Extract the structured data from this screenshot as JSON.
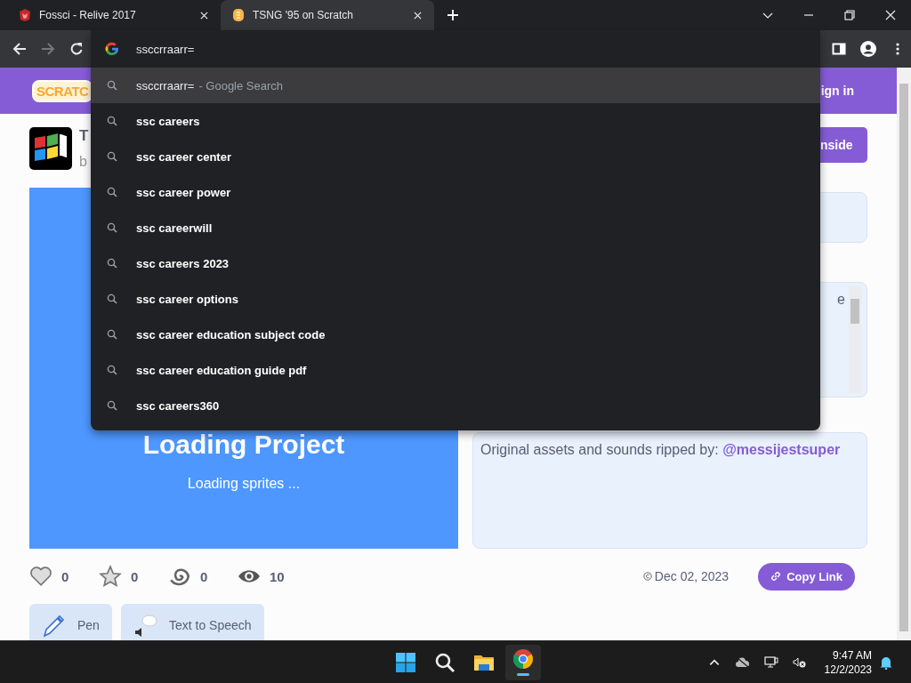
{
  "tabs": [
    {
      "title": "Fossci - Relive 2017",
      "selected": false
    },
    {
      "title": "TSNG '95 on Scratch",
      "selected": true
    }
  ],
  "omnibox": {
    "value": "ssccrraarr="
  },
  "suggestions": [
    {
      "text": "ssccrraarr=",
      "hint": "- Google Search",
      "selected": true
    },
    {
      "text": "ssc careers",
      "selected": false
    },
    {
      "text": "ssc career center",
      "selected": false
    },
    {
      "text": "ssc career power",
      "selected": false
    },
    {
      "text": "ssc careerwill",
      "selected": false
    },
    {
      "text": "ssc careers 2023",
      "selected": false
    },
    {
      "text": "ssc career options",
      "selected": false
    },
    {
      "text": "ssc career education subject code",
      "selected": false
    },
    {
      "text": "ssc career education guide pdf",
      "selected": false
    },
    {
      "text": "ssc careers360",
      "selected": false
    }
  ],
  "page": {
    "logo": "SCRATC",
    "sign_in": "ign in",
    "title_fragment": "T",
    "author_fragment": "b",
    "see_inside": "nside",
    "notes_fragment": "e",
    "stage": {
      "title": "Loading Project",
      "status": "Loading sprites ..."
    },
    "credits": {
      "text": "Original assets and sounds ripped by: ",
      "link": "@messijestsuper"
    },
    "stats": [
      {
        "kind": "love",
        "count": "0"
      },
      {
        "kind": "favorite",
        "count": "0"
      },
      {
        "kind": "remix",
        "count": "0"
      },
      {
        "kind": "view",
        "count": "10"
      }
    ],
    "date": "Dec 02, 2023",
    "copy_link": "Copy Link",
    "extensions": [
      {
        "kind": "pen",
        "label": "Pen"
      },
      {
        "kind": "speech",
        "label": "Text to Speech"
      }
    ]
  },
  "taskbar": {
    "time": "9:47 AM",
    "date": "12/2/2023"
  }
}
